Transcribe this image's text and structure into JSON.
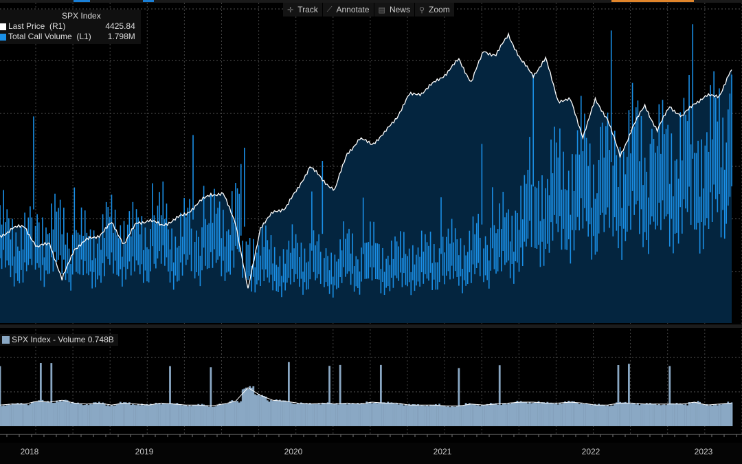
{
  "toolbar": {
    "track": "Track",
    "annotate": "Annotate",
    "news": "News",
    "zoom": "Zoom"
  },
  "legend": {
    "title": "SPX Index",
    "series": [
      {
        "label": "Last Price  (R1)",
        "value": "4425.84",
        "color": "#ffffff"
      },
      {
        "label": "Total Call Volume  (L1)",
        "value": "1.798M",
        "color": "#1e90ff"
      }
    ]
  },
  "legend2": {
    "label": "SPX Index - Volume 0.748B",
    "color": "#8aa8c4"
  },
  "colors": {
    "area": "#04253f",
    "call": "#1a8fe6",
    "vol": "#8aa8c4"
  },
  "chart_data": {
    "type": "line",
    "x_start": "2018-07",
    "x_end": "2023-06",
    "frequency": "monthly",
    "x_tick_labels": [
      "2018",
      "2019",
      "2020",
      "2021",
      "2022",
      "2023"
    ],
    "series": [
      {
        "name": "Last Price (R1)",
        "type": "area-line",
        "values": [
          2816,
          2901,
          2914,
          2711,
          2760,
          2400,
          2704,
          2784,
          2834,
          2946,
          2752,
          2942,
          2980,
          2926,
          2977,
          3038,
          3141,
          3231,
          3226,
          2954,
          2300,
          2912,
          3044,
          3100,
          3271,
          3500,
          3363,
          3270,
          3622,
          3756,
          3714,
          3811,
          3973,
          4181,
          4204,
          4298,
          4395,
          4523,
          4308,
          4605,
          4567,
          4766,
          4516,
          4374,
          4530,
          4132,
          4132,
          3785,
          4130,
          3955,
          3586,
          3872,
          4080,
          3840,
          4077,
          3970,
          4109,
          4169,
          4180,
          4426
        ]
      },
      {
        "name": "Total Call Volume (L1)",
        "unit": "M",
        "type": "bar",
        "values": [
          0.7,
          0.68,
          0.65,
          0.75,
          0.7,
          0.72,
          0.6,
          0.62,
          0.65,
          0.7,
          0.72,
          0.65,
          0.68,
          0.75,
          0.65,
          0.7,
          0.68,
          0.72,
          0.75,
          0.85,
          0.6,
          0.55,
          0.5,
          0.5,
          0.52,
          0.55,
          0.5,
          0.5,
          0.55,
          0.52,
          0.55,
          0.52,
          0.5,
          0.55,
          0.5,
          0.55,
          0.55,
          0.58,
          0.6,
          0.62,
          0.68,
          0.7,
          0.9,
          1.0,
          1.05,
          1.1,
          1.15,
          1.2,
          1.15,
          1.2,
          1.25,
          1.3,
          1.25,
          1.2,
          1.3,
          1.3,
          1.35,
          1.3,
          1.4,
          1.6
        ]
      },
      {
        "name": "SPX Index - Volume",
        "unit": "B",
        "type": "bar",
        "values": [
          2.2,
          2.3,
          2.3,
          2.6,
          2.5,
          2.7,
          2.4,
          2.3,
          2.4,
          2.2,
          2.4,
          2.3,
          2.2,
          2.4,
          2.3,
          2.2,
          2.2,
          2.1,
          2.3,
          2.6,
          4.0,
          3.2,
          2.7,
          2.6,
          2.4,
          2.3,
          2.4,
          2.3,
          2.4,
          2.3,
          2.5,
          2.4,
          2.4,
          2.2,
          2.2,
          2.2,
          2.1,
          2.1,
          2.3,
          2.2,
          2.3,
          2.4,
          2.5,
          2.5,
          2.4,
          2.4,
          2.5,
          2.4,
          2.2,
          2.2,
          2.4,
          2.4,
          2.3,
          2.3,
          2.3,
          2.3,
          2.5,
          2.2,
          2.3,
          2.4
        ]
      }
    ],
    "grid": true
  }
}
